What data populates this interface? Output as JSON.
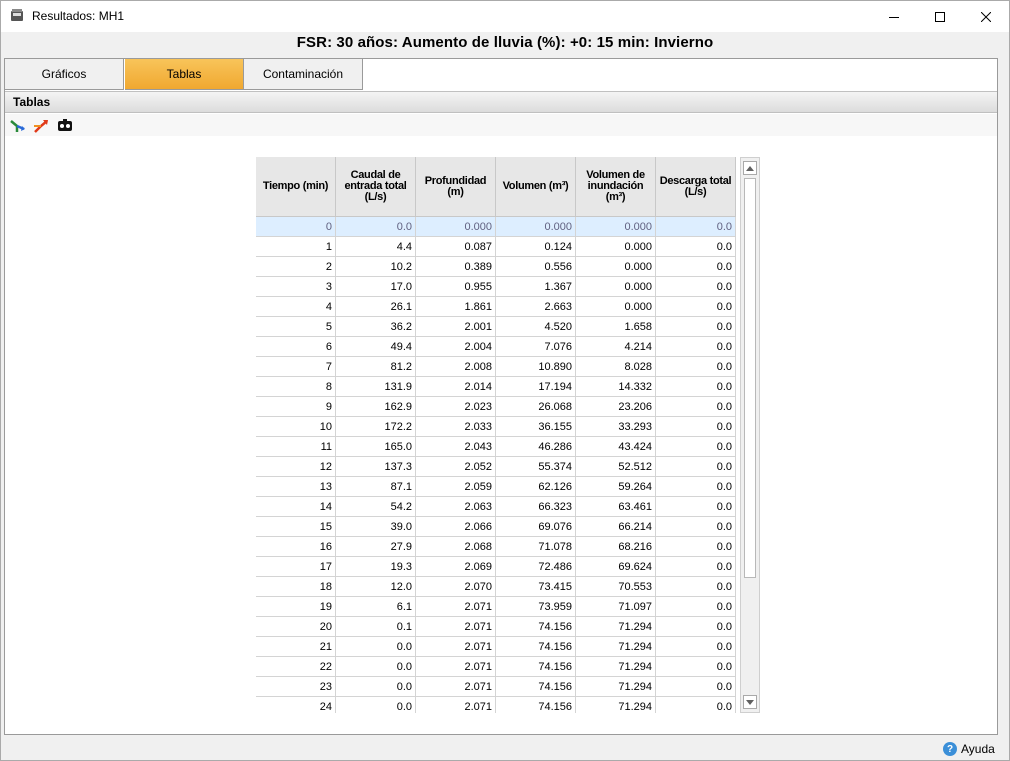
{
  "window": {
    "title": "Resultados: MH1",
    "heading": "FSR: 30 años: Aumento de lluvia (%): +0: 15 min: Invierno"
  },
  "tabs": [
    {
      "label": "Gráficos",
      "active": false
    },
    {
      "label": "Tablas",
      "active": true
    },
    {
      "label": "Contaminación",
      "active": false
    }
  ],
  "section": {
    "title": "Tablas"
  },
  "toolbar": {
    "icons": [
      "inflow-icon",
      "outflow-icon",
      "network-icon"
    ]
  },
  "table": {
    "columns": [
      "Tiempo (min)",
      "Caudal de entrada total (L/s)",
      "Profundidad (m)",
      "Volumen (m³)",
      "Volumen de inundación (m³)",
      "Descarga total (L/s)"
    ],
    "rows": [
      [
        "0",
        "0.0",
        "0.000",
        "0.000",
        "0.000",
        "0.0"
      ],
      [
        "1",
        "4.4",
        "0.087",
        "0.124",
        "0.000",
        "0.0"
      ],
      [
        "2",
        "10.2",
        "0.389",
        "0.556",
        "0.000",
        "0.0"
      ],
      [
        "3",
        "17.0",
        "0.955",
        "1.367",
        "0.000",
        "0.0"
      ],
      [
        "4",
        "26.1",
        "1.861",
        "2.663",
        "0.000",
        "0.0"
      ],
      [
        "5",
        "36.2",
        "2.001",
        "4.520",
        "1.658",
        "0.0"
      ],
      [
        "6",
        "49.4",
        "2.004",
        "7.076",
        "4.214",
        "0.0"
      ],
      [
        "7",
        "81.2",
        "2.008",
        "10.890",
        "8.028",
        "0.0"
      ],
      [
        "8",
        "131.9",
        "2.014",
        "17.194",
        "14.332",
        "0.0"
      ],
      [
        "9",
        "162.9",
        "2.023",
        "26.068",
        "23.206",
        "0.0"
      ],
      [
        "10",
        "172.2",
        "2.033",
        "36.155",
        "33.293",
        "0.0"
      ],
      [
        "11",
        "165.0",
        "2.043",
        "46.286",
        "43.424",
        "0.0"
      ],
      [
        "12",
        "137.3",
        "2.052",
        "55.374",
        "52.512",
        "0.0"
      ],
      [
        "13",
        "87.1",
        "2.059",
        "62.126",
        "59.264",
        "0.0"
      ],
      [
        "14",
        "54.2",
        "2.063",
        "66.323",
        "63.461",
        "0.0"
      ],
      [
        "15",
        "39.0",
        "2.066",
        "69.076",
        "66.214",
        "0.0"
      ],
      [
        "16",
        "27.9",
        "2.068",
        "71.078",
        "68.216",
        "0.0"
      ],
      [
        "17",
        "19.3",
        "2.069",
        "72.486",
        "69.624",
        "0.0"
      ],
      [
        "18",
        "12.0",
        "2.070",
        "73.415",
        "70.553",
        "0.0"
      ],
      [
        "19",
        "6.1",
        "2.071",
        "73.959",
        "71.097",
        "0.0"
      ],
      [
        "20",
        "0.1",
        "2.071",
        "74.156",
        "71.294",
        "0.0"
      ],
      [
        "21",
        "0.0",
        "2.071",
        "74.156",
        "71.294",
        "0.0"
      ],
      [
        "22",
        "0.0",
        "2.071",
        "74.156",
        "71.294",
        "0.0"
      ],
      [
        "23",
        "0.0",
        "2.071",
        "74.156",
        "71.294",
        "0.0"
      ],
      [
        "24",
        "0.0",
        "2.071",
        "74.156",
        "71.294",
        "0.0"
      ]
    ],
    "selected_row": 0
  },
  "footer": {
    "help_label": "Ayuda"
  },
  "colors": {
    "active_tab": "#f0a830",
    "selected_row": "#ddeeff",
    "help_icon": "#3b8fd8"
  }
}
